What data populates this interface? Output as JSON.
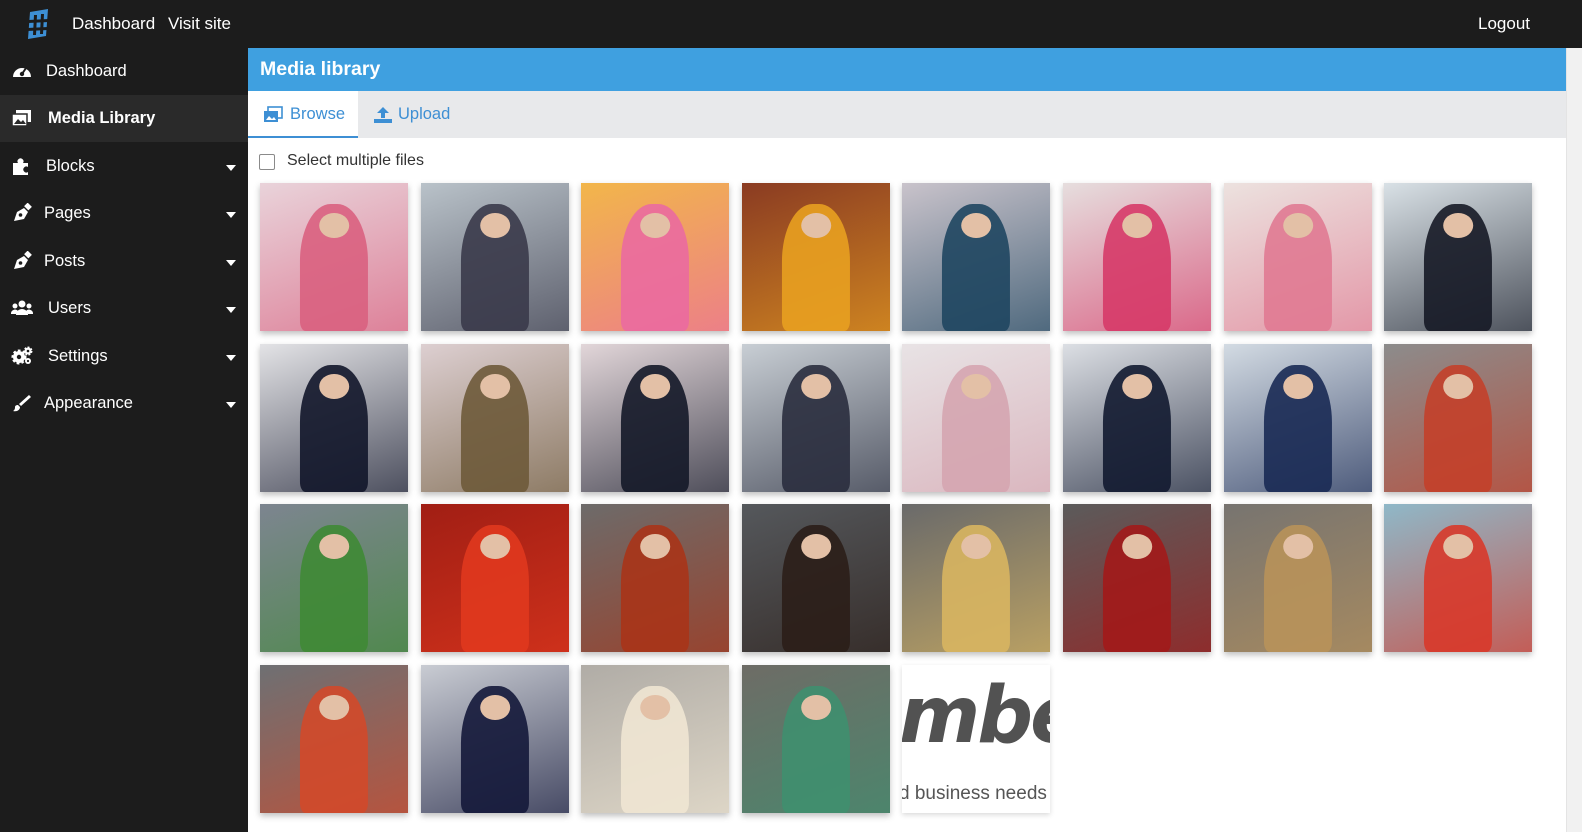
{
  "topbar": {
    "links": [
      "Dashboard",
      "Visit site"
    ],
    "logout": "Logout"
  },
  "sidebar": {
    "items": [
      {
        "label": "Dashboard",
        "icon": "gauge-icon",
        "has_submenu": false,
        "active": false
      },
      {
        "label": "Media Library",
        "icon": "images-icon",
        "has_submenu": false,
        "active": true
      },
      {
        "label": "Blocks",
        "icon": "puzzle-icon",
        "has_submenu": true,
        "active": false
      },
      {
        "label": "Pages",
        "icon": "pen-nib-icon",
        "has_submenu": true,
        "active": false
      },
      {
        "label": "Posts",
        "icon": "pen-nib-icon",
        "has_submenu": true,
        "active": false
      },
      {
        "label": "Users",
        "icon": "users-icon",
        "has_submenu": true,
        "active": false
      },
      {
        "label": "Settings",
        "icon": "cogs-icon",
        "has_submenu": true,
        "active": false
      },
      {
        "label": "Appearance",
        "icon": "brush-icon",
        "has_submenu": true,
        "active": false
      }
    ]
  },
  "page": {
    "title": "Media library"
  },
  "tabs": [
    {
      "label": "Browse",
      "icon": "images-icon",
      "active": true
    },
    {
      "label": "Upload",
      "icon": "upload-icon",
      "active": false
    }
  ],
  "select_multiple": {
    "label": "Select multiple files",
    "checked": false
  },
  "media": {
    "thumbnails": [
      {
        "bg": "#e9d3da",
        "accent": "#d9607f"
      },
      {
        "bg": "#b9c2c9",
        "accent": "#3a3a4a"
      },
      {
        "bg": "#f2b64a",
        "accent": "#ea6aa0"
      },
      {
        "bg": "#8a3b22",
        "accent": "#e8a020"
      },
      {
        "bg": "#c9c3cb",
        "accent": "#1f4660"
      },
      {
        "bg": "#e6dede",
        "accent": "#d63a68"
      },
      {
        "bg": "#ece2df",
        "accent": "#e07a92"
      },
      {
        "bg": "#d9e1e6",
        "accent": "#161a26"
      },
      {
        "bg": "#e3e3e6",
        "accent": "#12162a"
      },
      {
        "bg": "#ddcfd1",
        "accent": "#6e5a3a"
      },
      {
        "bg": "#e2d6d9",
        "accent": "#141828"
      },
      {
        "bg": "#c8ced4",
        "accent": "#2a2e3e"
      },
      {
        "bg": "#e8e3e5",
        "accent": "#d5a5b0"
      },
      {
        "bg": "#dcdfe4",
        "accent": "#121a30"
      },
      {
        "bg": "#d3dbe3",
        "accent": "#1a2a54"
      },
      {
        "bg": "#8c8c8c",
        "accent": "#c3402a"
      },
      {
        "bg": "#7d8590",
        "accent": "#3f8a35"
      },
      {
        "bg": "#a11e14",
        "accent": "#e0381e"
      },
      {
        "bg": "#6d6b6a",
        "accent": "#a83418"
      },
      {
        "bg": "#55585c",
        "accent": "#2b1e18"
      },
      {
        "bg": "#6a6a6a",
        "accent": "#d8b560"
      },
      {
        "bg": "#5b5b5b",
        "accent": "#a21a1a"
      },
      {
        "bg": "#777470",
        "accent": "#b8925a"
      },
      {
        "bg": "#8fb8c8",
        "accent": "#d8392a"
      },
      {
        "bg": "#6e7073",
        "accent": "#d2492a"
      },
      {
        "bg": "#c9ccd3",
        "accent": "#14183a"
      },
      {
        "bg": "#b0aca6",
        "accent": "#efe6d3"
      },
      {
        "bg": "#6e6c66",
        "accent": "#3f8f6f"
      }
    ],
    "logo_thumbnail": {
      "word": "mbe",
      "tagline": "d business needs a"
    }
  }
}
